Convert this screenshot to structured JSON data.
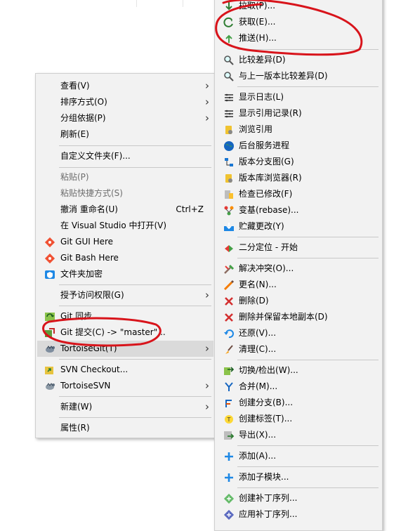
{
  "left_menu": {
    "view": "查看(V)",
    "sort": "排序方式(O)",
    "group": "分组依据(P)",
    "refresh": "刷新(E)",
    "customize": "自定义文件夹(F)...",
    "paste": "粘贴(P)",
    "paste_shortcut": "粘贴快捷方式(S)",
    "undo": "撤消 重命名(U)",
    "undo_shortcut": "Ctrl+Z",
    "open_vs": "在 Visual Studio 中打开(V)",
    "git_gui": "Git GUI Here",
    "git_bash": "Git Bash Here",
    "encrypt": "文件夹加密",
    "give_access": "授予访问权限(G)",
    "git_sync": "Git 同步...",
    "git_commit": "Git 提交(C) -> \"master\"...",
    "tortoisegit": "TortoiseGit(T)",
    "svn_checkout": "SVN Checkout...",
    "tortoisesvn": "TortoiseSVN",
    "new": "新建(W)",
    "properties": "属性(R)"
  },
  "right_menu": {
    "pull": "拉取(P)...",
    "fetch": "获取(E)...",
    "push": "推送(H)...",
    "diff": "比较差异(D)",
    "diff_prev": "与上一版本比较差异(D)",
    "show_log": "显示日志(L)",
    "show_reflog": "显示引用记录(R)",
    "browse_refs": "浏览引用",
    "daemon": "后台服务进程",
    "revision_graph": "版本分支图(G)",
    "repo_browser": "版本库浏览器(R)",
    "check_mods": "检查已修改(F)",
    "rebase": "变基(rebase)...",
    "stash": "贮藏更改(Y)",
    "bisect": "二分定位 - 开始",
    "resolve": "解决冲突(O)...",
    "rename": "更名(N)...",
    "delete": "删除(D)",
    "delete_keep": "删除并保留本地副本(D)",
    "revert": "还原(V)...",
    "cleanup": "清理(C)...",
    "switch": "切换/检出(W)...",
    "merge": "合并(M)...",
    "branch": "创建分支(B)...",
    "tag": "创建标签(T)...",
    "export": "导出(X)...",
    "add": "添加(A)...",
    "submodule_add": "添加子模块...",
    "create_patch": "创建补丁序列...",
    "apply_patch": "应用补丁序列..."
  },
  "colors": {
    "menu_bg": "#f2f2f2",
    "highlight": "#dadada",
    "annotation": "#d8141b"
  }
}
